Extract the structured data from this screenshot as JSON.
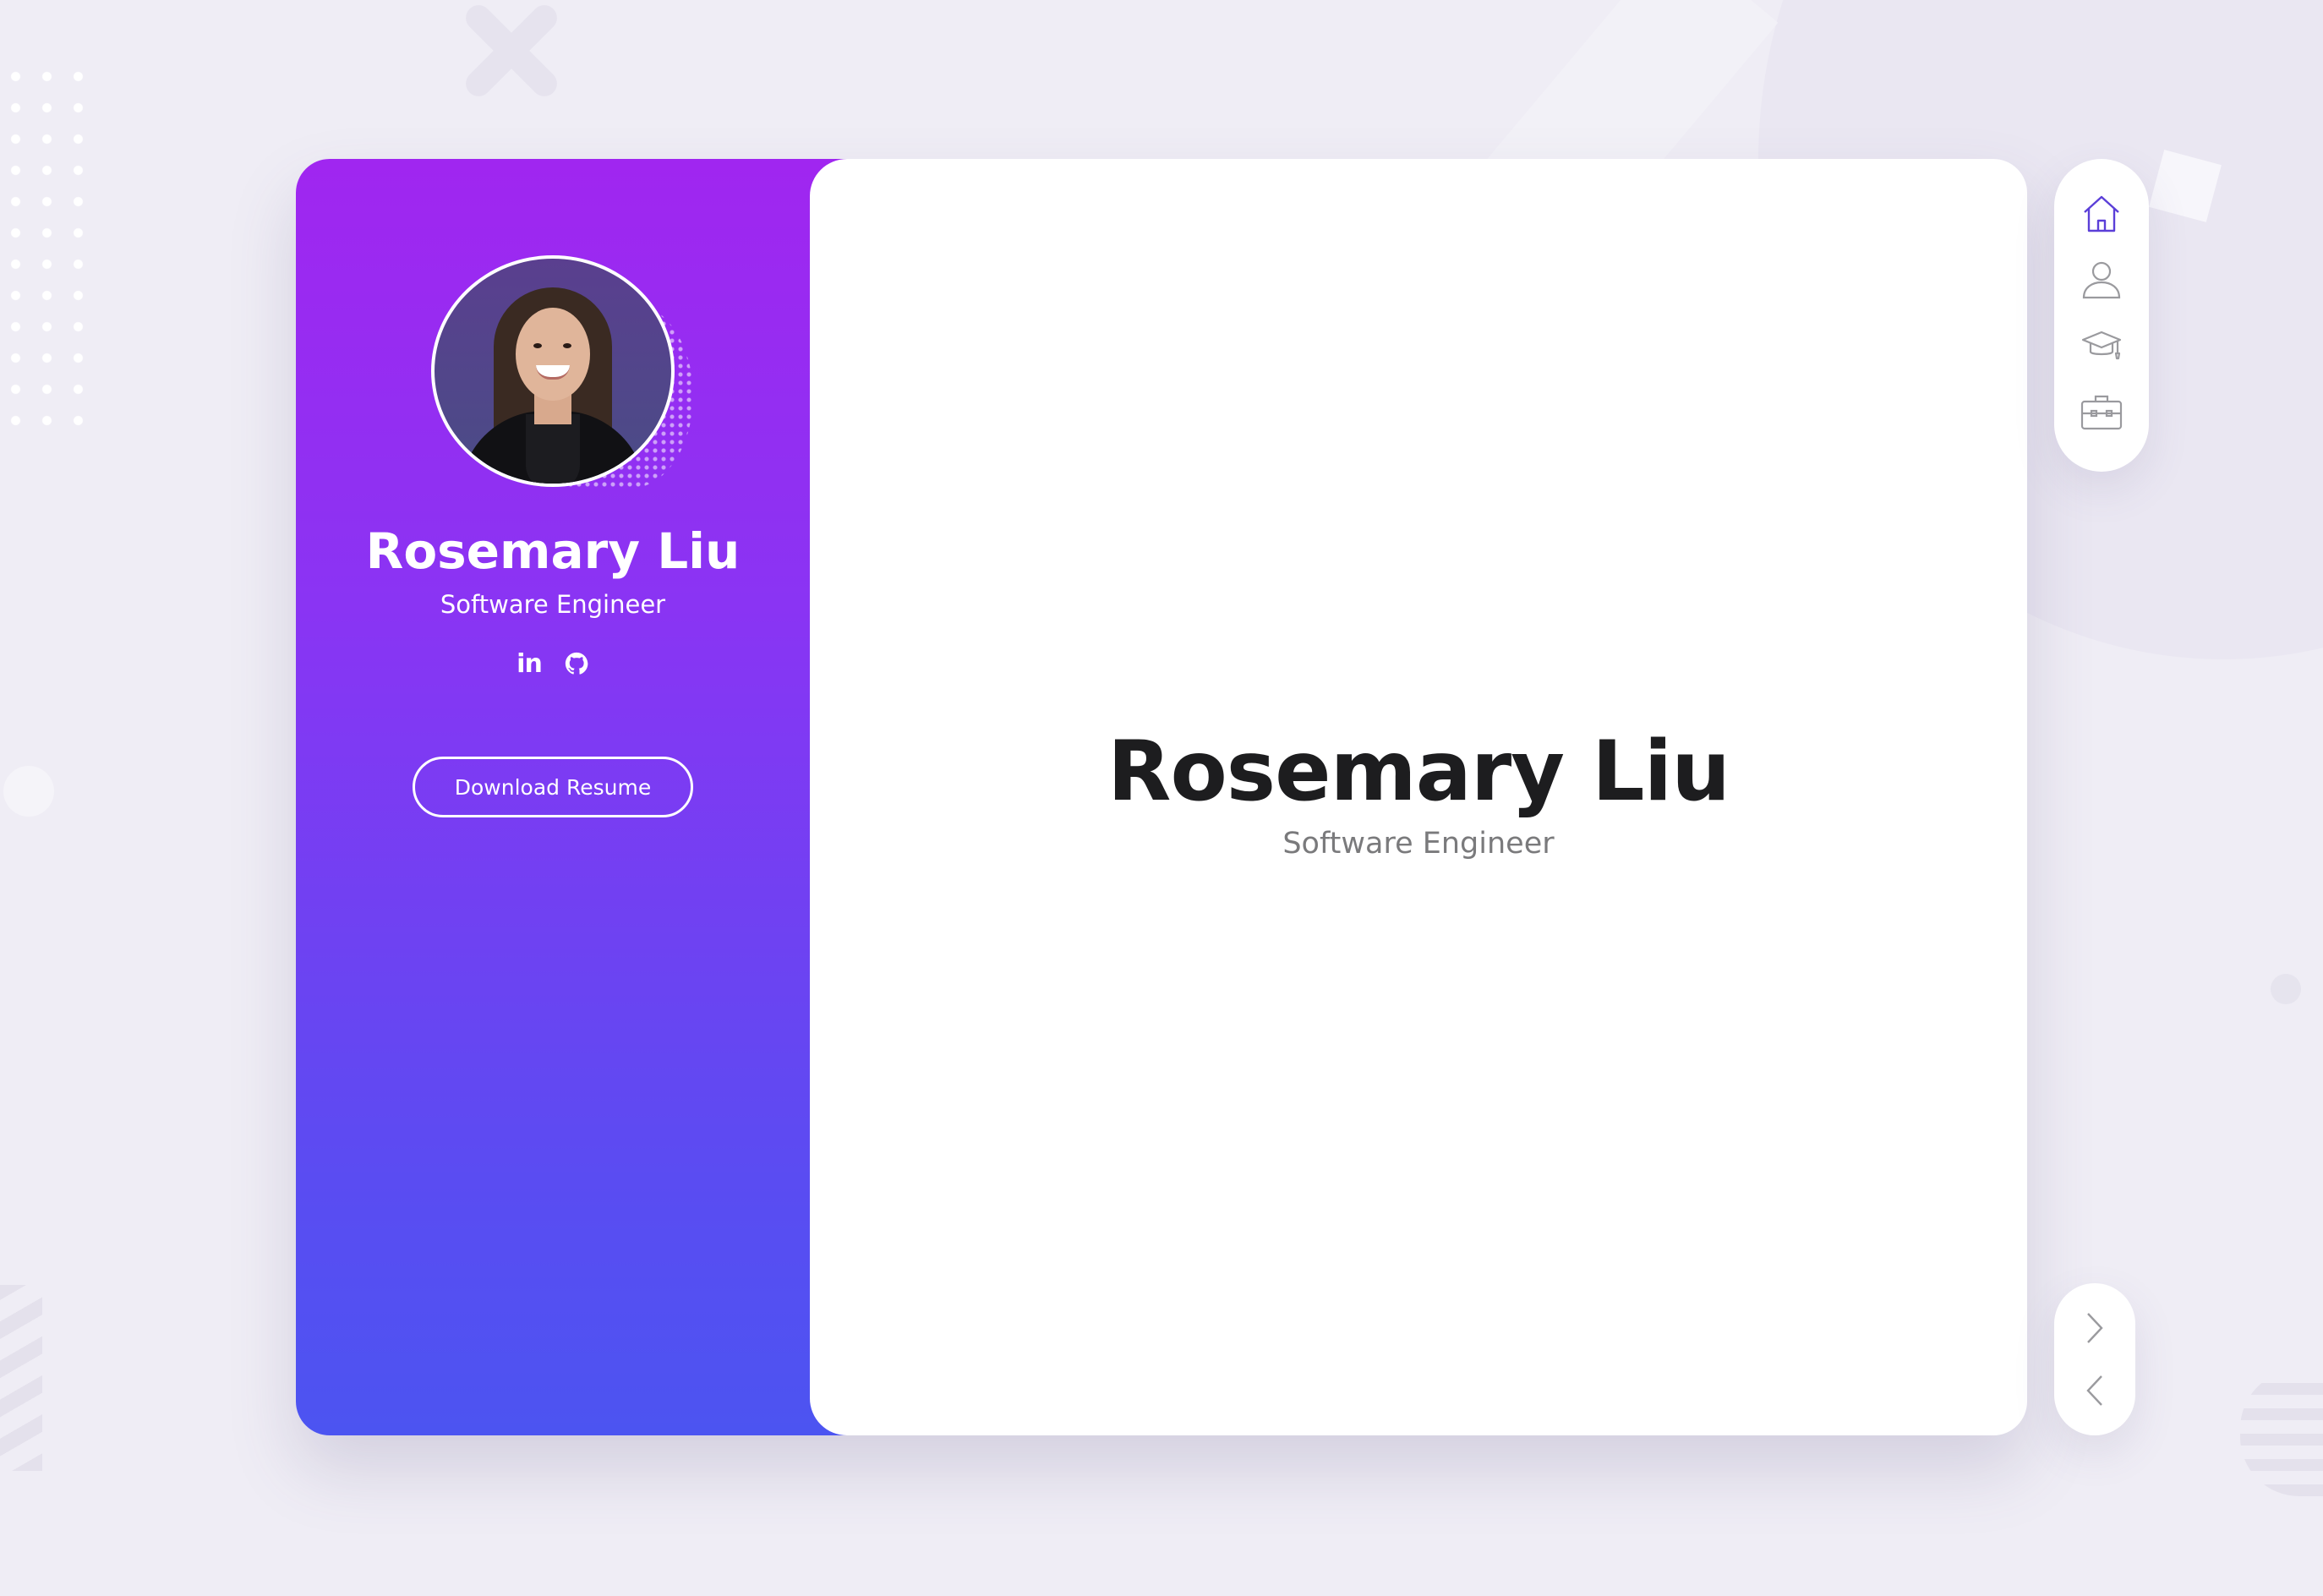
{
  "profile": {
    "name": "Rosemary Liu",
    "role": "Software Engineer",
    "linkedin_label": "in"
  },
  "sidebar": {
    "download_label": "Download Resume"
  },
  "main": {
    "name": "Rosemary Liu",
    "role": "Software Engineer"
  },
  "nav": {
    "items": [
      {
        "icon": "home-icon",
        "active": true
      },
      {
        "icon": "user-icon",
        "active": false
      },
      {
        "icon": "graduation-cap-icon",
        "active": false
      },
      {
        "icon": "briefcase-icon",
        "active": false
      }
    ]
  },
  "colors": {
    "accent": "#5b3fd8",
    "gradient_top": "#a026f0",
    "gradient_bottom": "#4c54f1"
  }
}
